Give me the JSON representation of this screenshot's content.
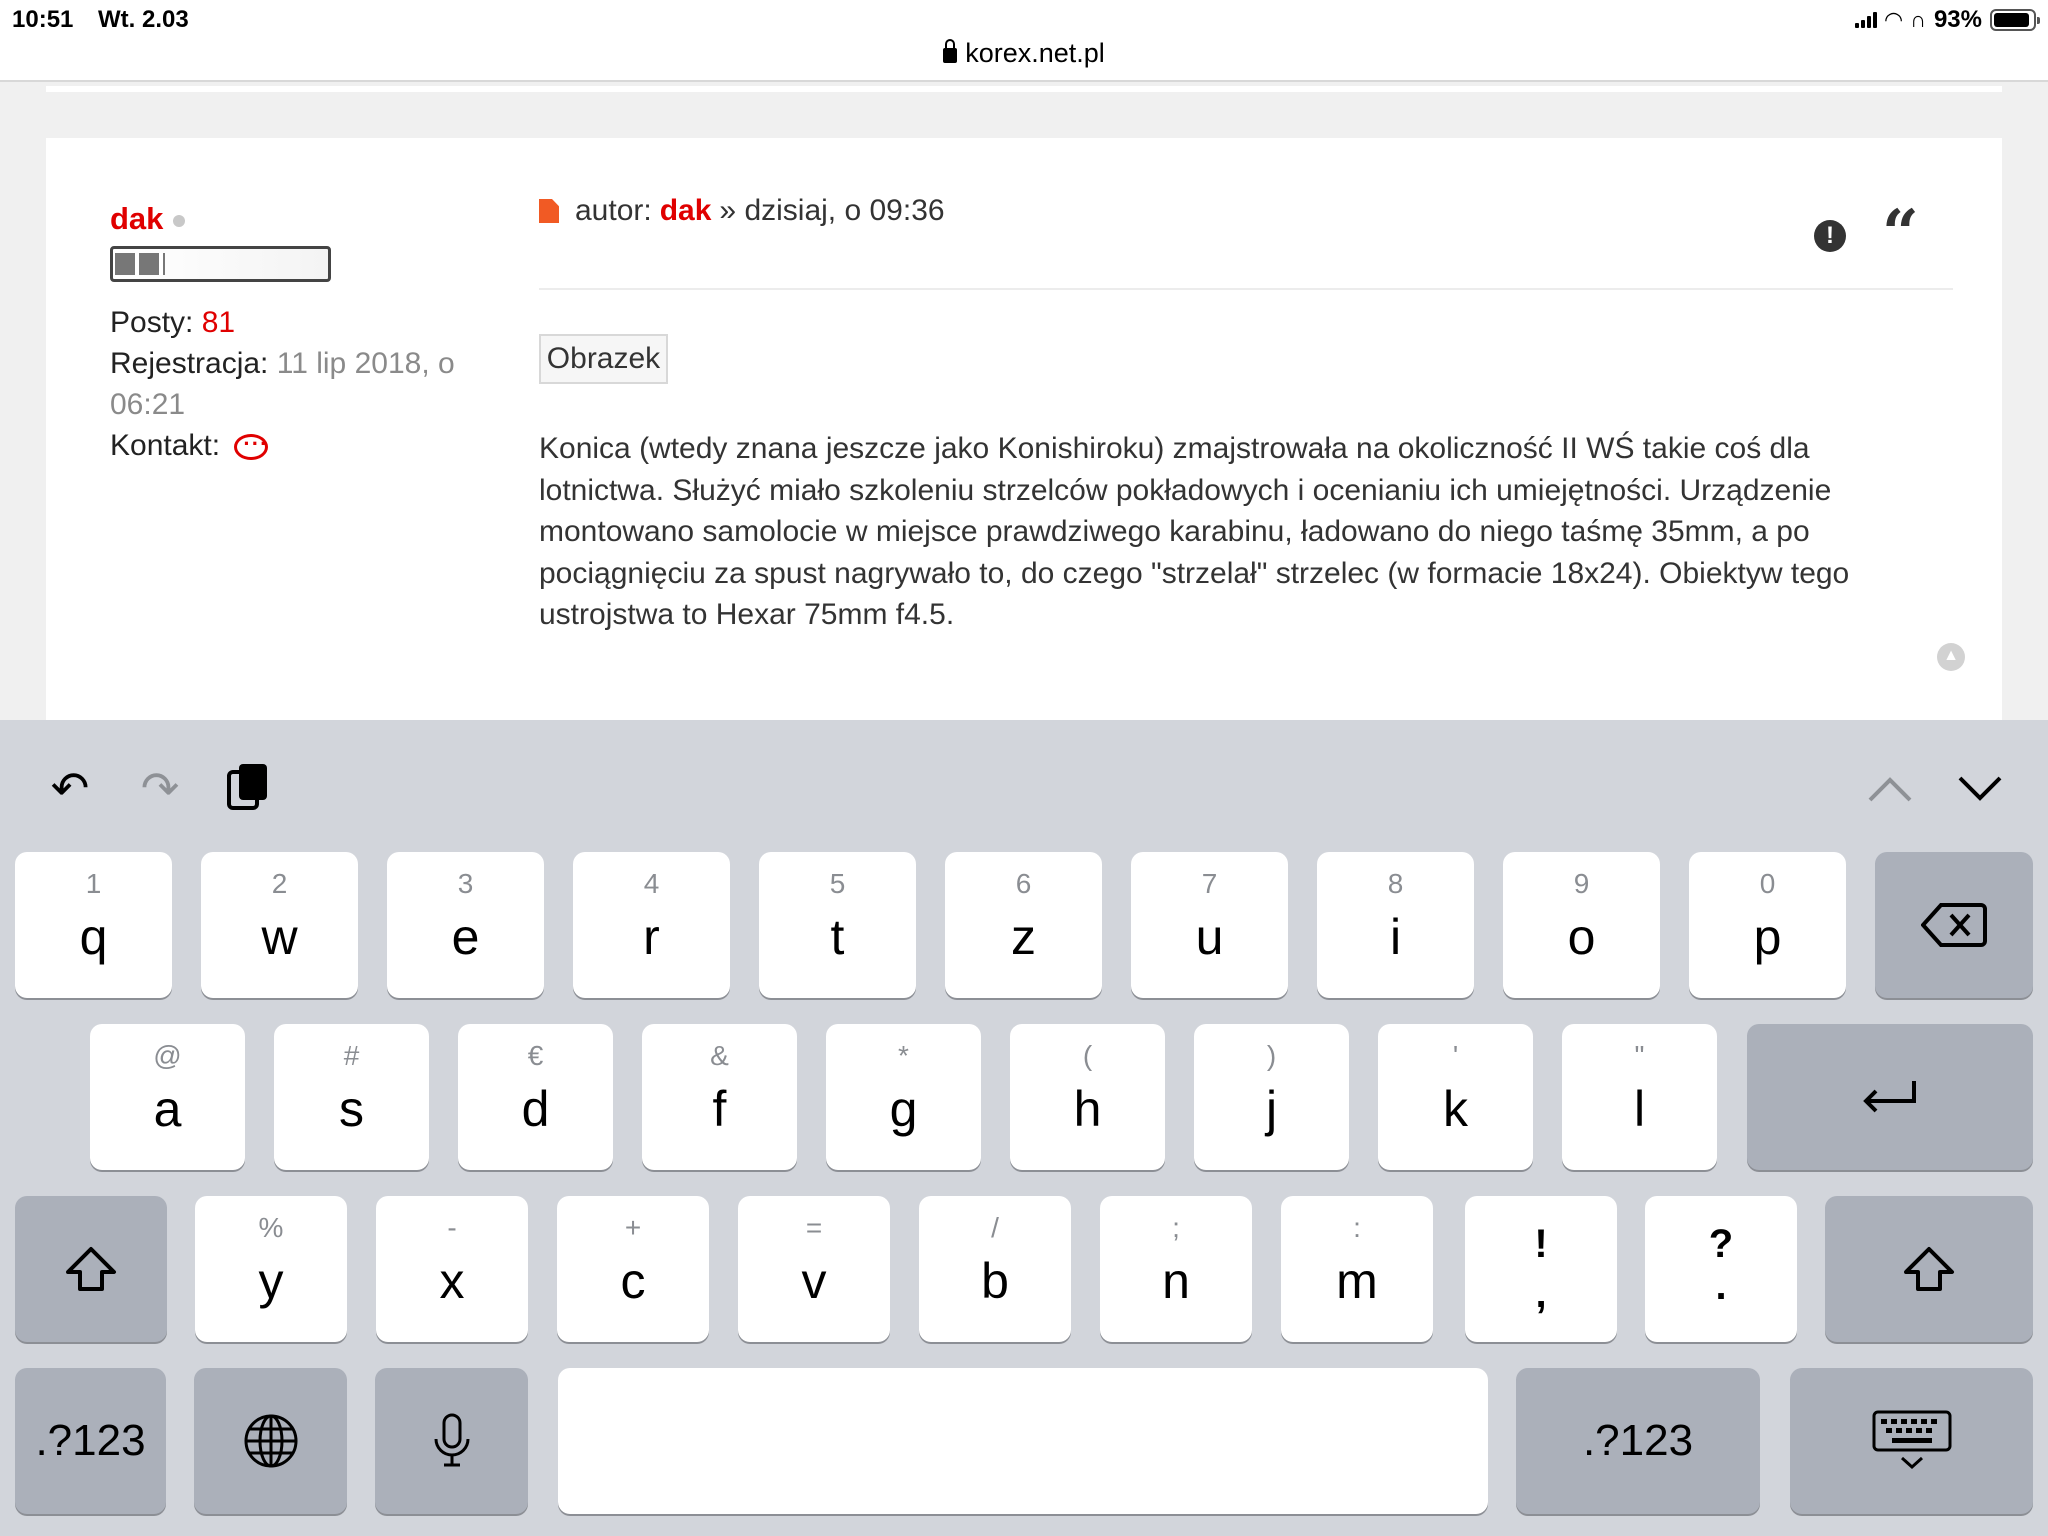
{
  "status_bar": {
    "time": "10:51",
    "date": "Wt. 2.03",
    "url": "korex.net.pl",
    "battery": "93%",
    "battery_level": 0.93
  },
  "post": {
    "author_name": "dak",
    "posts_label": "Posty:",
    "posts_count": "81",
    "registration_label": "Rejestracja:",
    "registration_value_1": "11 lip 2018, o",
    "registration_value_2": "06:21",
    "contact_label": "Kontakt:",
    "head_prefix": "autor:",
    "head_author": "dak",
    "head_suffix": "» dzisiaj, o 09:36",
    "image_button": "Obrazek",
    "body_lines": [
      "Konica (wtedy znana jeszcze jako Konishiroku) zmajstrowała na okoliczność II WŚ takie coś dla",
      "lotnictwa. Służyć miało szkoleniu strzelców pokładowych i ocenianiu ich umiejętności. Urządzenie",
      "montowano samolocie w miejsce prawdziwego karabinu, ładowano do niego taśmę 35mm, a po",
      "pociągnięciu za spust nagrywało to, do czego \"strzelał\" strzelec (w formacie 18x24). Obiektyw tego",
      "ustrojstwa to Hexar 75mm f4.5."
    ]
  },
  "keyboard": {
    "row1": [
      {
        "sec": "1",
        "pri": "q"
      },
      {
        "sec": "2",
        "pri": "w"
      },
      {
        "sec": "3",
        "pri": "e"
      },
      {
        "sec": "4",
        "pri": "r"
      },
      {
        "sec": "5",
        "pri": "t"
      },
      {
        "sec": "6",
        "pri": "z"
      },
      {
        "sec": "7",
        "pri": "u"
      },
      {
        "sec": "8",
        "pri": "i"
      },
      {
        "sec": "9",
        "pri": "o"
      },
      {
        "sec": "0",
        "pri": "p"
      }
    ],
    "row2": [
      {
        "sec": "@",
        "pri": "a"
      },
      {
        "sec": "#",
        "pri": "s"
      },
      {
        "sec": "€",
        "pri": "d"
      },
      {
        "sec": "&",
        "pri": "f"
      },
      {
        "sec": "*",
        "pri": "g"
      },
      {
        "sec": "(",
        "pri": "h"
      },
      {
        "sec": ")",
        "pri": "j"
      },
      {
        "sec": "'",
        "pri": "k"
      },
      {
        "sec": "\"",
        "pri": "l"
      }
    ],
    "row3": [
      {
        "sec": "%",
        "pri": "y"
      },
      {
        "sec": "-",
        "pri": "x"
      },
      {
        "sec": "+",
        "pri": "c"
      },
      {
        "sec": "=",
        "pri": "v"
      },
      {
        "sec": "/",
        "pri": "b"
      },
      {
        "sec": ";",
        "pri": "n"
      },
      {
        "sec": ":",
        "pri": "m"
      }
    ],
    "excl_top": "!",
    "excl_bottom": ",",
    "quest_top": "?",
    "quest_bottom": ".",
    "num_label": ".?123",
    "icons": {
      "undo": "undo-icon",
      "redo": "redo-icon",
      "paste": "clipboard-icon",
      "prev": "chevron-up-icon",
      "next": "chevron-down-icon",
      "delete": "delete-icon",
      "return": "return-icon",
      "shift": "shift-icon",
      "globe": "globe-icon",
      "mic": "microphone-icon",
      "hide": "keyboard-hide-icon"
    }
  }
}
